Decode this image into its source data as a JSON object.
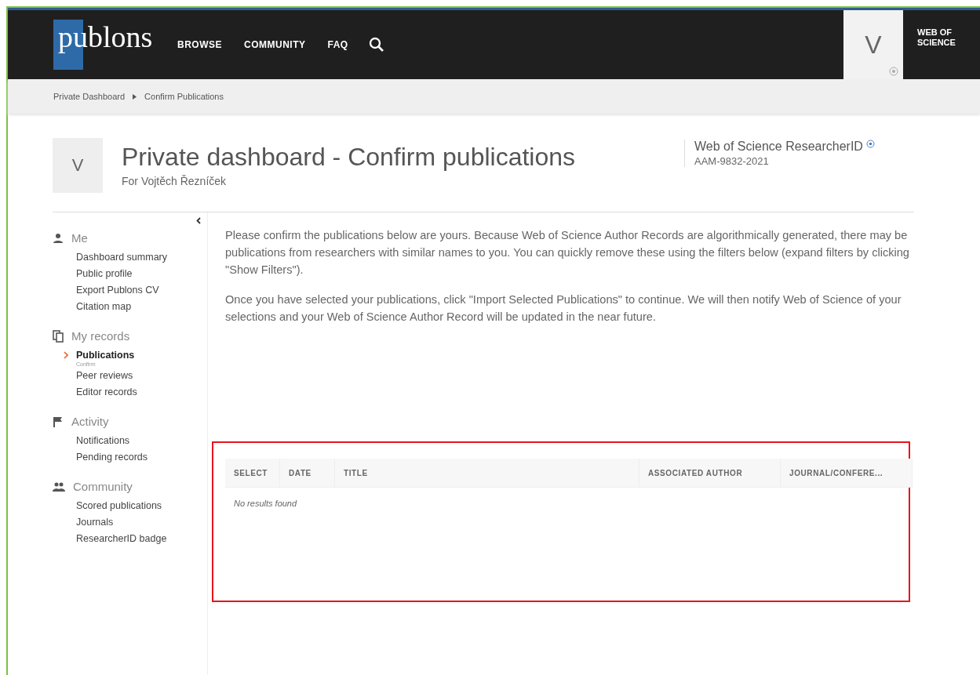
{
  "header": {
    "logo": "publons",
    "nav": [
      {
        "label": "BROWSE"
      },
      {
        "label": "COMMUNITY"
      },
      {
        "label": "FAQ"
      }
    ],
    "avatar_letter": "V",
    "brand_link": "WEB OF SCIENCE"
  },
  "breadcrumb": [
    "Private Dashboard",
    "Confirm Publications"
  ],
  "profile": {
    "avatar_letter": "V",
    "title": "Private dashboard - Confirm publications",
    "subtitle": "For Vojtěch Řezníček",
    "researcher_id_label": "Web of Science ResearcherID",
    "researcher_id": "AAM-9832-2021"
  },
  "sidebar": {
    "sections": [
      {
        "kind": "person",
        "label": "Me",
        "items": [
          {
            "label": "Dashboard summary",
            "selected": false
          },
          {
            "label": "Public profile",
            "selected": false
          },
          {
            "label": "Export Publons CV",
            "selected": false
          },
          {
            "label": "Citation map",
            "selected": false
          }
        ]
      },
      {
        "kind": "records",
        "label": "My records",
        "items": [
          {
            "label": "Publications",
            "selected": true,
            "sub": "Confirm"
          },
          {
            "label": "Peer reviews",
            "selected": false
          },
          {
            "label": "Editor records",
            "selected": false
          }
        ]
      },
      {
        "kind": "flag",
        "label": "Activity",
        "items": [
          {
            "label": "Notifications",
            "selected": false
          },
          {
            "label": "Pending records",
            "selected": false
          }
        ]
      },
      {
        "kind": "people",
        "label": "Community",
        "items": [
          {
            "label": "Scored publications",
            "selected": false
          },
          {
            "label": "Journals",
            "selected": false
          },
          {
            "label": "ResearcherID badge",
            "selected": false
          }
        ]
      }
    ]
  },
  "intro": [
    "Please confirm the publications below are yours. Because Web of Science Author Records are algorithmically generated, there may be publications from researchers with similar names to you. You can quickly remove these using the filters below (expand filters by clicking \"Show Filters\").",
    "Once you have selected your publications, click \"Import Selected Publications\" to continue. We will then notify Web of Science of your selections and your Web of Science Author Record will be updated in the near future."
  ],
  "table": {
    "columns": [
      "SELECT",
      "DATE",
      "TITLE",
      "ASSOCIATED AUTHOR",
      "JOURNAL/CONFERE..."
    ],
    "empty_message": "No results found"
  }
}
